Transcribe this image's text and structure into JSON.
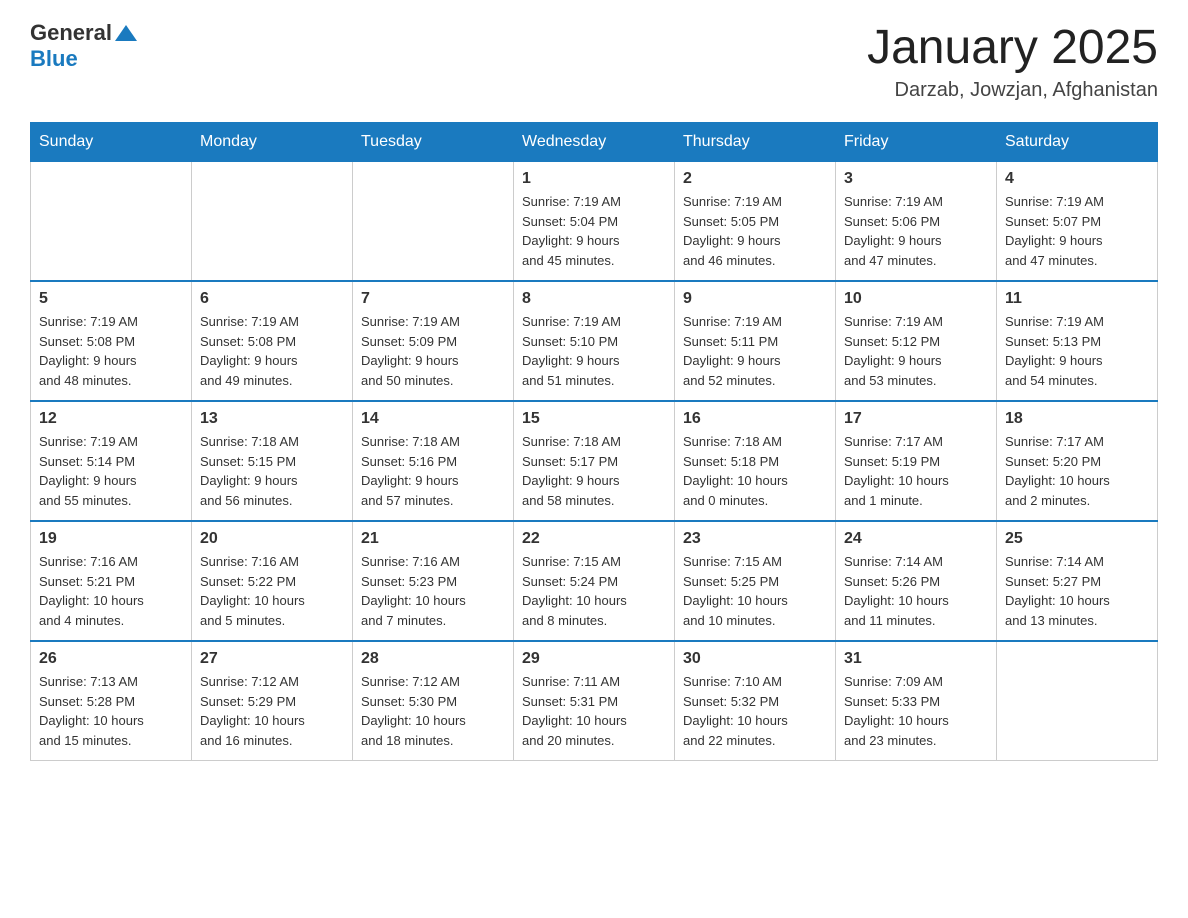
{
  "logo": {
    "general": "General",
    "blue": "Blue"
  },
  "title": "January 2025",
  "subtitle": "Darzab, Jowzjan, Afghanistan",
  "days": [
    "Sunday",
    "Monday",
    "Tuesday",
    "Wednesday",
    "Thursday",
    "Friday",
    "Saturday"
  ],
  "weeks": [
    [
      {
        "day": "",
        "info": ""
      },
      {
        "day": "",
        "info": ""
      },
      {
        "day": "",
        "info": ""
      },
      {
        "day": "1",
        "info": "Sunrise: 7:19 AM\nSunset: 5:04 PM\nDaylight: 9 hours\nand 45 minutes."
      },
      {
        "day": "2",
        "info": "Sunrise: 7:19 AM\nSunset: 5:05 PM\nDaylight: 9 hours\nand 46 minutes."
      },
      {
        "day": "3",
        "info": "Sunrise: 7:19 AM\nSunset: 5:06 PM\nDaylight: 9 hours\nand 47 minutes."
      },
      {
        "day": "4",
        "info": "Sunrise: 7:19 AM\nSunset: 5:07 PM\nDaylight: 9 hours\nand 47 minutes."
      }
    ],
    [
      {
        "day": "5",
        "info": "Sunrise: 7:19 AM\nSunset: 5:08 PM\nDaylight: 9 hours\nand 48 minutes."
      },
      {
        "day": "6",
        "info": "Sunrise: 7:19 AM\nSunset: 5:08 PM\nDaylight: 9 hours\nand 49 minutes."
      },
      {
        "day": "7",
        "info": "Sunrise: 7:19 AM\nSunset: 5:09 PM\nDaylight: 9 hours\nand 50 minutes."
      },
      {
        "day": "8",
        "info": "Sunrise: 7:19 AM\nSunset: 5:10 PM\nDaylight: 9 hours\nand 51 minutes."
      },
      {
        "day": "9",
        "info": "Sunrise: 7:19 AM\nSunset: 5:11 PM\nDaylight: 9 hours\nand 52 minutes."
      },
      {
        "day": "10",
        "info": "Sunrise: 7:19 AM\nSunset: 5:12 PM\nDaylight: 9 hours\nand 53 minutes."
      },
      {
        "day": "11",
        "info": "Sunrise: 7:19 AM\nSunset: 5:13 PM\nDaylight: 9 hours\nand 54 minutes."
      }
    ],
    [
      {
        "day": "12",
        "info": "Sunrise: 7:19 AM\nSunset: 5:14 PM\nDaylight: 9 hours\nand 55 minutes."
      },
      {
        "day": "13",
        "info": "Sunrise: 7:18 AM\nSunset: 5:15 PM\nDaylight: 9 hours\nand 56 minutes."
      },
      {
        "day": "14",
        "info": "Sunrise: 7:18 AM\nSunset: 5:16 PM\nDaylight: 9 hours\nand 57 minutes."
      },
      {
        "day": "15",
        "info": "Sunrise: 7:18 AM\nSunset: 5:17 PM\nDaylight: 9 hours\nand 58 minutes."
      },
      {
        "day": "16",
        "info": "Sunrise: 7:18 AM\nSunset: 5:18 PM\nDaylight: 10 hours\nand 0 minutes."
      },
      {
        "day": "17",
        "info": "Sunrise: 7:17 AM\nSunset: 5:19 PM\nDaylight: 10 hours\nand 1 minute."
      },
      {
        "day": "18",
        "info": "Sunrise: 7:17 AM\nSunset: 5:20 PM\nDaylight: 10 hours\nand 2 minutes."
      }
    ],
    [
      {
        "day": "19",
        "info": "Sunrise: 7:16 AM\nSunset: 5:21 PM\nDaylight: 10 hours\nand 4 minutes."
      },
      {
        "day": "20",
        "info": "Sunrise: 7:16 AM\nSunset: 5:22 PM\nDaylight: 10 hours\nand 5 minutes."
      },
      {
        "day": "21",
        "info": "Sunrise: 7:16 AM\nSunset: 5:23 PM\nDaylight: 10 hours\nand 7 minutes."
      },
      {
        "day": "22",
        "info": "Sunrise: 7:15 AM\nSunset: 5:24 PM\nDaylight: 10 hours\nand 8 minutes."
      },
      {
        "day": "23",
        "info": "Sunrise: 7:15 AM\nSunset: 5:25 PM\nDaylight: 10 hours\nand 10 minutes."
      },
      {
        "day": "24",
        "info": "Sunrise: 7:14 AM\nSunset: 5:26 PM\nDaylight: 10 hours\nand 11 minutes."
      },
      {
        "day": "25",
        "info": "Sunrise: 7:14 AM\nSunset: 5:27 PM\nDaylight: 10 hours\nand 13 minutes."
      }
    ],
    [
      {
        "day": "26",
        "info": "Sunrise: 7:13 AM\nSunset: 5:28 PM\nDaylight: 10 hours\nand 15 minutes."
      },
      {
        "day": "27",
        "info": "Sunrise: 7:12 AM\nSunset: 5:29 PM\nDaylight: 10 hours\nand 16 minutes."
      },
      {
        "day": "28",
        "info": "Sunrise: 7:12 AM\nSunset: 5:30 PM\nDaylight: 10 hours\nand 18 minutes."
      },
      {
        "day": "29",
        "info": "Sunrise: 7:11 AM\nSunset: 5:31 PM\nDaylight: 10 hours\nand 20 minutes."
      },
      {
        "day": "30",
        "info": "Sunrise: 7:10 AM\nSunset: 5:32 PM\nDaylight: 10 hours\nand 22 minutes."
      },
      {
        "day": "31",
        "info": "Sunrise: 7:09 AM\nSunset: 5:33 PM\nDaylight: 10 hours\nand 23 minutes."
      },
      {
        "day": "",
        "info": ""
      }
    ]
  ]
}
